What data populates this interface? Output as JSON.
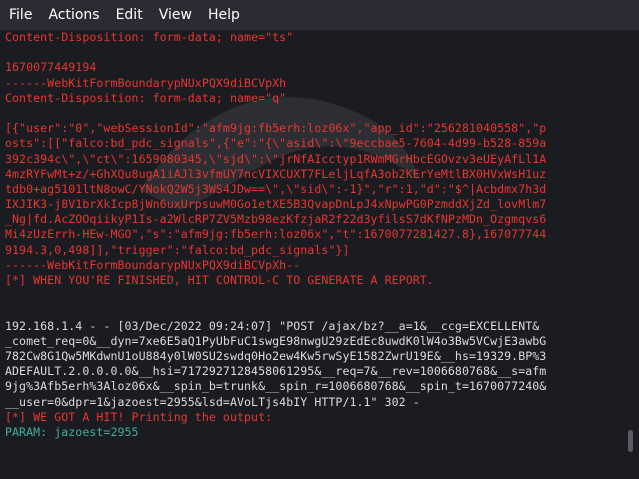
{
  "menu": {
    "file": "File",
    "actions": "Actions",
    "edit": "Edit",
    "view": "View",
    "help": "Help"
  },
  "terminal": {
    "top_lines": [
      "Content-Disposition: form-data; name=\"ts\"",
      "",
      "1670077449194",
      "------WebKitFormBoundarypNUxPQX9diBCVpXh",
      "Content-Disposition: form-data; name=\"q\"",
      "",
      "[{\"user\":\"0\",\"webSessionId\":\"afm9jg:fb5erh:loz06x\",\"app_id\":\"256281040558\",\"p",
      "osts\":[[\"falco:bd_pdc_signals\",{\"e\":\"{\\\"asid\\\":\\\"9eccbae5-7604-4d99-b528-859a",
      "392c394c\\\",\\\"ct\\\":1659080345,\\\"sjd\\\":\\\"jrNfAIcctyp1RWmMGrHbcEGOvzv3eUEyAfLl1A",
      "4mzRYFwMt+z/+GhXQu8ugA1iAJl3vfmUY7ncVIXCUXT7FLeljLqfA3ob2KErYeMtlBX0HVxWsH1uz",
      "tdb0+ag5101ltN8owC/YNokQ2W5j3WS4JDw==\\\",\\\"sid\\\":-1}\",\"r\":1,\"d\":\"$^|Acbdmx7h3d",
      "IXJIK3-j8V1brXkIcp8jWn6uxUrpsuwM0Go1etXE5B3QvapDnLpJ4xNpwPG0PzmddXjZd_lovMlm7",
      "_Ng|fd.AcZOOqiikyP1Is-a2WlcRP7ZV5Mzb98ezKfzjaR2f22d3yfilsS7dKfNPzMDn_Ozgmqvs6",
      "Mi4zUzErrh-HEw-MGO\",\"s\":\"afm9jg:fb5erh:loz06x\",\"t\":1670077281427.8},167077744",
      "9194.3,0,498]],\"trigger\":\"falco:bd_pdc_signals\"}]",
      "------WebKitFormBoundarypNUxPQX9diBCVpXh--",
      "[*] WHEN YOU'RE FINISHED, HIT CONTROL-C TO GENERATE A REPORT."
    ],
    "request_lines": [
      "192.168.1.4 - - [03/Dec/2022 09:24:07] \"POST /ajax/bz?__a=1&__ccg=EXCELLENT&",
      "_comet_req=0&__dyn=7xe6E5aQ1PyUbFuC1swgE98nwgU29zEdEc8uwdK0lW4o3Bw5VCwjE3awbG",
      "782Cw8G1Qw5MKdwnU1oU884y0lW0SU2swdq0Ho2ew4Kw5rwSyE1582ZwrU19E&__hs=19329.BP%3",
      "ADEFAULT.2.0.0.0.0&__hsi=7172927128458061295&__req=7&__rev=1006680768&__s=afm",
      "9jg%3Afb5erh%3Aloz06x&__spin_b=trunk&__spin_r=1006680768&__spin_t=1670077240&",
      "__user=0&dpr=1&jazoest=2955&lsd=AVoLTjs4bIY HTTP/1.1\" 302 -"
    ],
    "hit_line": "[*] WE GOT A HIT! Printing the output:",
    "param_line": "PARAM: jazoest=2955"
  }
}
